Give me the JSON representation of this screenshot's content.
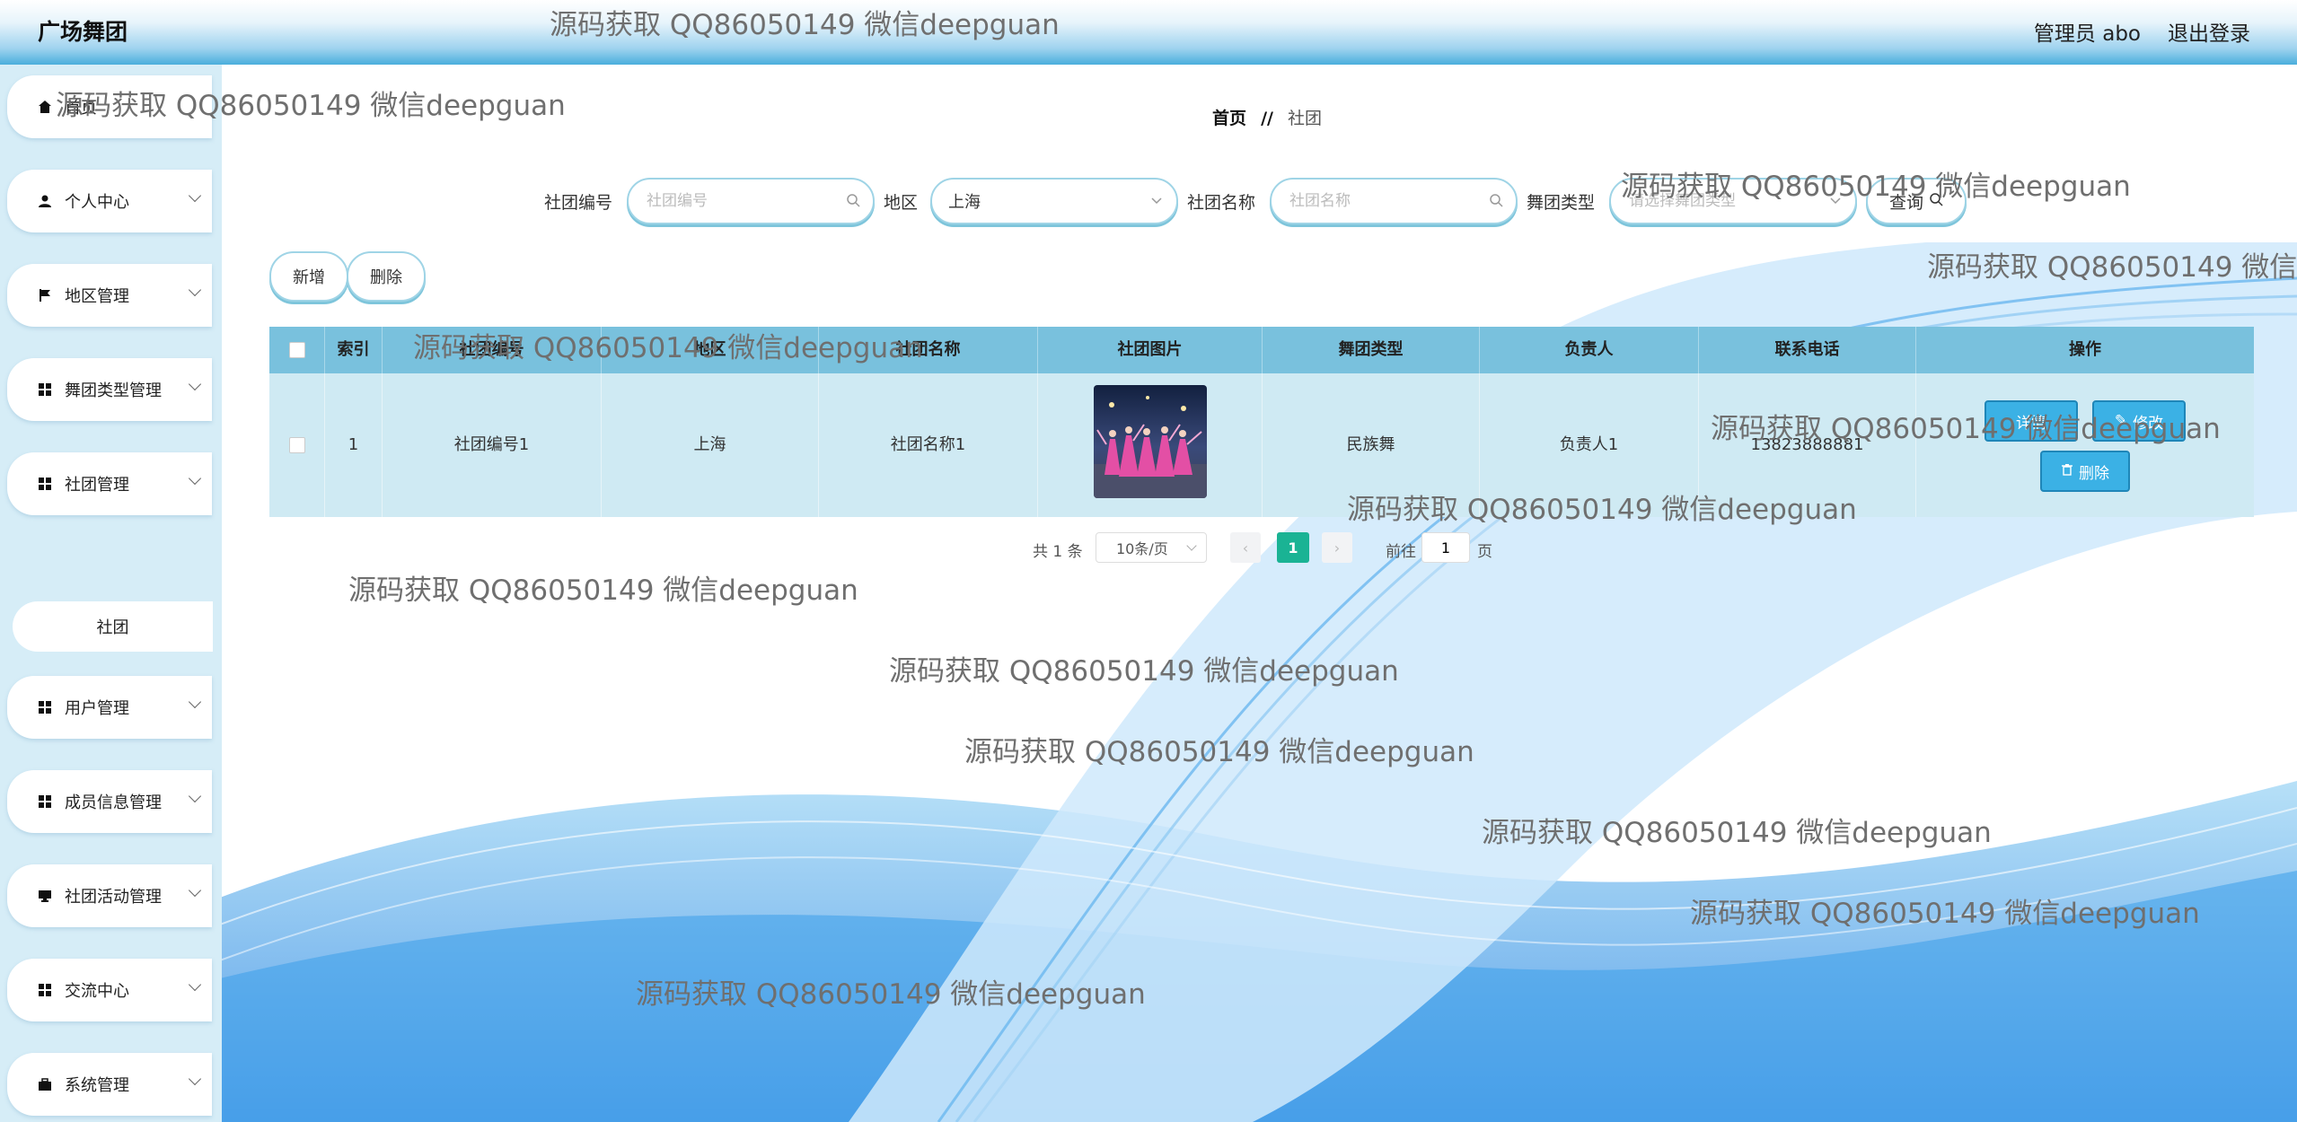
{
  "header": {
    "app_title": "广场舞团",
    "user_label": "管理员 abo",
    "logout_label": "退出登录"
  },
  "sidebar": {
    "items": [
      {
        "label": "首页",
        "icon": "home-icon"
      },
      {
        "label": "个人中心",
        "icon": "user-icon"
      },
      {
        "label": "地区管理",
        "icon": "flag-icon"
      },
      {
        "label": "舞团类型管理",
        "icon": "grid-icon"
      },
      {
        "label": "社团管理",
        "icon": "grid-icon"
      },
      {
        "label": "用户管理",
        "icon": "grid-icon"
      },
      {
        "label": "成员信息管理",
        "icon": "grid-icon"
      },
      {
        "label": "社团活动管理",
        "icon": "monitor-icon"
      },
      {
        "label": "交流中心",
        "icon": "grid-icon"
      },
      {
        "label": "系统管理",
        "icon": "briefcase-icon"
      }
    ],
    "sub_item": "社团"
  },
  "breadcrumb": {
    "home": "首页",
    "separator": "//",
    "current": "社团"
  },
  "search": {
    "club_no_label": "社团编号",
    "club_no_placeholder": "社团编号",
    "region_label": "地区",
    "region_value": "上海",
    "club_name_label": "社团名称",
    "club_name_placeholder": "社团名称",
    "dance_type_label": "舞团类型",
    "dance_type_placeholder": "请选择舞团类型",
    "query_label": "查询"
  },
  "actions": {
    "add_label": "新增",
    "delete_label": "删除"
  },
  "table": {
    "columns": [
      "索引",
      "社团编号",
      "地区",
      "社团名称",
      "社团图片",
      "舞团类型",
      "负责人",
      "联系电话",
      "操作"
    ],
    "rows": [
      {
        "index": "1",
        "club_no": "社团编号1",
        "region": "上海",
        "club_name": "社团名称1",
        "dance_type": "民族舞",
        "leader": "负责人1",
        "phone": "13823888881"
      }
    ],
    "row_actions": {
      "detail": "详情",
      "edit": "修改",
      "delete": "删除"
    }
  },
  "pagination": {
    "total": "共 1 条",
    "page_size": "10条/页",
    "current_page": "1",
    "goto_label": "前往",
    "goto_value": "1",
    "goto_unit": "页"
  },
  "watermark": "源码获取 QQ86050149 微信deepguan",
  "colors": {
    "header_gradient_bottom": "#4aaedc",
    "sidebar_bg": "#d6edf7",
    "table_header_bg": "#79c1dd",
    "table_row_bg": "#cfeaf3",
    "primary_button": "#3bb1e5",
    "pager_active": "#1ab394"
  }
}
